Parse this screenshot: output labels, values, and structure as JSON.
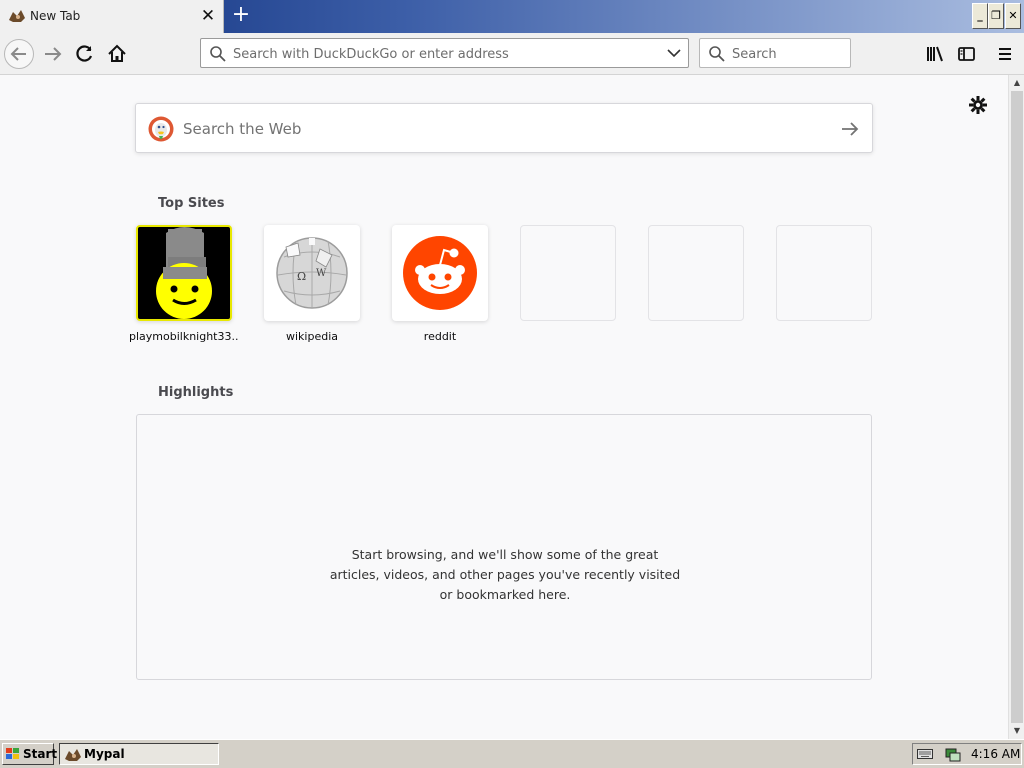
{
  "tab": {
    "title": "New Tab",
    "close": "✕",
    "new_tab": "+"
  },
  "window_controls": {
    "minimize": "_",
    "restore": "❐",
    "close": "✕"
  },
  "toolbar": {
    "url_placeholder": "Search with DuckDuckGo or enter address",
    "search_placeholder": "Search"
  },
  "newtab": {
    "web_search_placeholder": "Search the Web",
    "top_sites_title": "Top Sites",
    "top_sites": [
      {
        "label": "playmobilknight33...",
        "icon": "playmobil-knight-icon"
      },
      {
        "label": "wikipedia",
        "icon": "wikipedia-globe-icon"
      },
      {
        "label": "reddit",
        "icon": "reddit-alien-icon"
      },
      {
        "label": "",
        "icon": ""
      },
      {
        "label": "",
        "icon": ""
      },
      {
        "label": "",
        "icon": ""
      }
    ],
    "highlights_title": "Highlights",
    "highlights_message": "Start browsing, and we'll show some of the great articles, videos, and other pages you've recently visited or bookmarked here."
  },
  "taskbar": {
    "start_label": "Start",
    "task_label": "Mypal",
    "clock": "4:16 AM"
  },
  "colors": {
    "reddit": "#ff4500",
    "highlight_border": "#e8e800",
    "titlebar": "#0b2c7a"
  }
}
